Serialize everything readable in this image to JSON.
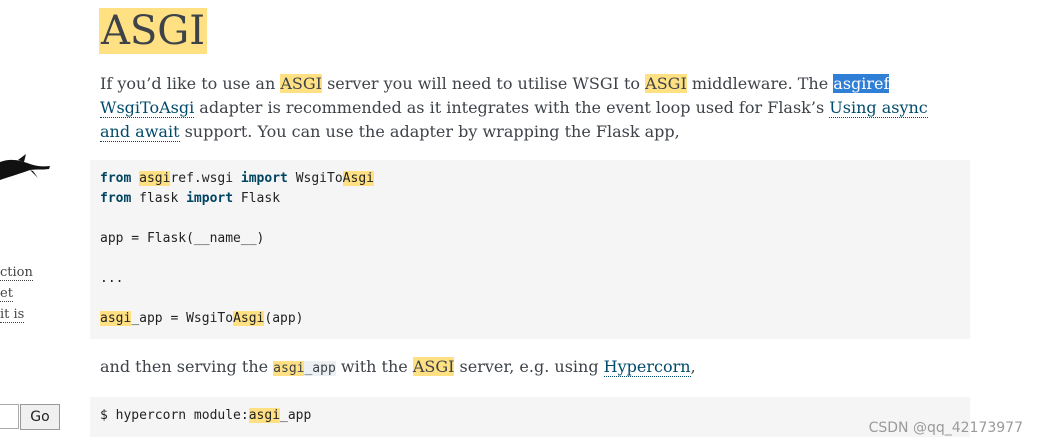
{
  "sidebar": {
    "links": [
      "ction",
      "et",
      "it is"
    ],
    "go_label": "Go"
  },
  "section": {
    "title": "ASGI",
    "intro": {
      "t1": "If you’d like to use an ",
      "asgi1": "ASGI",
      "t2": " server you will need to utilise WSGI to ",
      "asgi2": "ASGI",
      "t3": " middleware. The ",
      "asgiref_link": "asgiref",
      "wsgitoasgi_link": "WsgiToAsgi",
      "t4": " adapter is recommended as it integrates with the event loop used for Flask’s ",
      "async_link": "Using async and await",
      "t5": " support. You can use the adapter by wrapping the Flask app,"
    },
    "code1": {
      "l1_from": "from",
      "l1_hl1": "asgi",
      "l1_mid": "ref.wsgi",
      "l1_import": "import",
      "l1_cls": " WsgiTo",
      "l1_hl2": "Asgi",
      "l2_from": "from",
      "l2_mid": " flask ",
      "l2_import": "import",
      "l2_end": " Flask",
      "l3": "app = Flask(__name__)",
      "l4": "...",
      "l5_hl1": "asgi",
      "l5_mid": "_app = WsgiTo",
      "l5_hl2": "Asgi",
      "l5_end": "(app)"
    },
    "serving": {
      "t1": "and then serving the ",
      "code_hl": "asgi",
      "code_rest": "_app",
      "t2": " with the ",
      "asgi": "ASGI",
      "t3": " server, e.g. using ",
      "hypercorn_link": "Hypercorn",
      "t4": ","
    },
    "code2": {
      "pre": "$ hypercorn module:",
      "hl": "asgi",
      "post": "_app"
    }
  },
  "watermark": "CSDN @qq_42173977",
  "colors": {
    "highlight": "#ffe082",
    "selection": "#2f7fd6",
    "link": "#004b6b",
    "code_bg": "#f5f5f5"
  }
}
